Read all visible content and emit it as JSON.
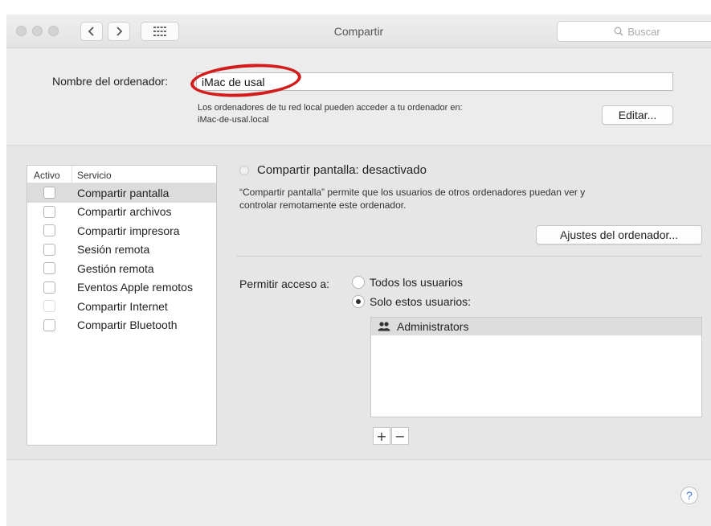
{
  "window": {
    "title": "Compartir",
    "search_placeholder": "Buscar",
    "search_icon": "magnifier-icon",
    "nav_icons": [
      "chevron-left-icon",
      "chevron-right-icon",
      "grid-icon"
    ]
  },
  "computer": {
    "name_label": "Nombre del ordenador:",
    "name_value": "iMac de usal",
    "info_line1": "Los ordenadores de tu red local pueden acceder a tu ordenador en:",
    "info_line2": "iMac-de-usal.local",
    "edit_label": "Editar..."
  },
  "services": {
    "col_active": "Activo",
    "col_service": "Servicio",
    "items": [
      {
        "label": "Compartir pantalla",
        "checked": false,
        "selected": true
      },
      {
        "label": "Compartir archivos",
        "checked": false
      },
      {
        "label": "Compartir impresora",
        "checked": false
      },
      {
        "label": "Sesión remota",
        "checked": false
      },
      {
        "label": "Gestión remota",
        "checked": false
      },
      {
        "label": "Eventos Apple remotos",
        "checked": false
      },
      {
        "label": "Compartir Internet",
        "checked": false,
        "disabled": true
      },
      {
        "label": "Compartir Bluetooth",
        "checked": false
      }
    ]
  },
  "detail": {
    "status": "Compartir pantalla: desactivado",
    "description_line1": "“Compartir pantalla” permite que los usuarios de otros ordenadores puedan ver y",
    "description_line2": "controlar remotamente este ordenador.",
    "settings_label": "Ajustes del ordenador...",
    "access_label": "Permitir acceso a:",
    "option_all": "Todos los usuarios",
    "option_only": "Solo estos usuarios:",
    "selected_option": "only",
    "users": [
      {
        "name": "Administrators",
        "icon": "group-icon"
      }
    ],
    "add_label": "+",
    "remove_label": "−"
  },
  "help_label": "?",
  "colors": {
    "highlight_ring": "#d31d1d",
    "help_accent": "#3a6fd8"
  }
}
